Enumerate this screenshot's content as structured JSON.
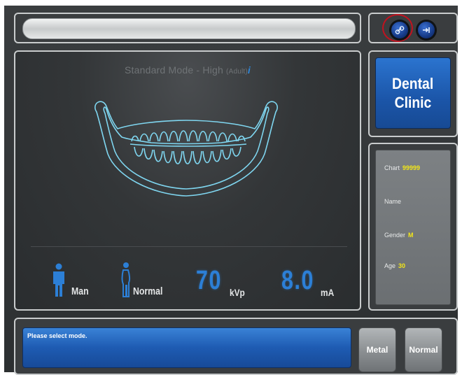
{
  "header": {
    "link_icon": "link-icon",
    "exit_icon": "exit-icon"
  },
  "main": {
    "mode_prefix": "Standard Mode - High ",
    "mode_sub": "(Adult)",
    "mode_info": "i",
    "person_label": "Man",
    "body_label": "Normal",
    "kvp_value": "70",
    "kvp_unit": "kVp",
    "ma_value": "8.0",
    "ma_unit": "mA"
  },
  "clinic": {
    "line1": "Dental",
    "line2": "Clinic"
  },
  "patient": {
    "chart_label": "Chart",
    "chart_value": "99999",
    "name_label": "Name",
    "gender_label": "Gender",
    "gender_value": "M",
    "age_label": "Age",
    "age_value": "30"
  },
  "footer": {
    "message": "Please select mode.",
    "metal_label": "Metal",
    "normal_label": "Normal"
  },
  "colors": {
    "accent_blue": "#2c7fd6",
    "highlight_red": "#c1121f",
    "value_yellow": "#f2e619",
    "jaw_outline": "#7fd6f0"
  }
}
